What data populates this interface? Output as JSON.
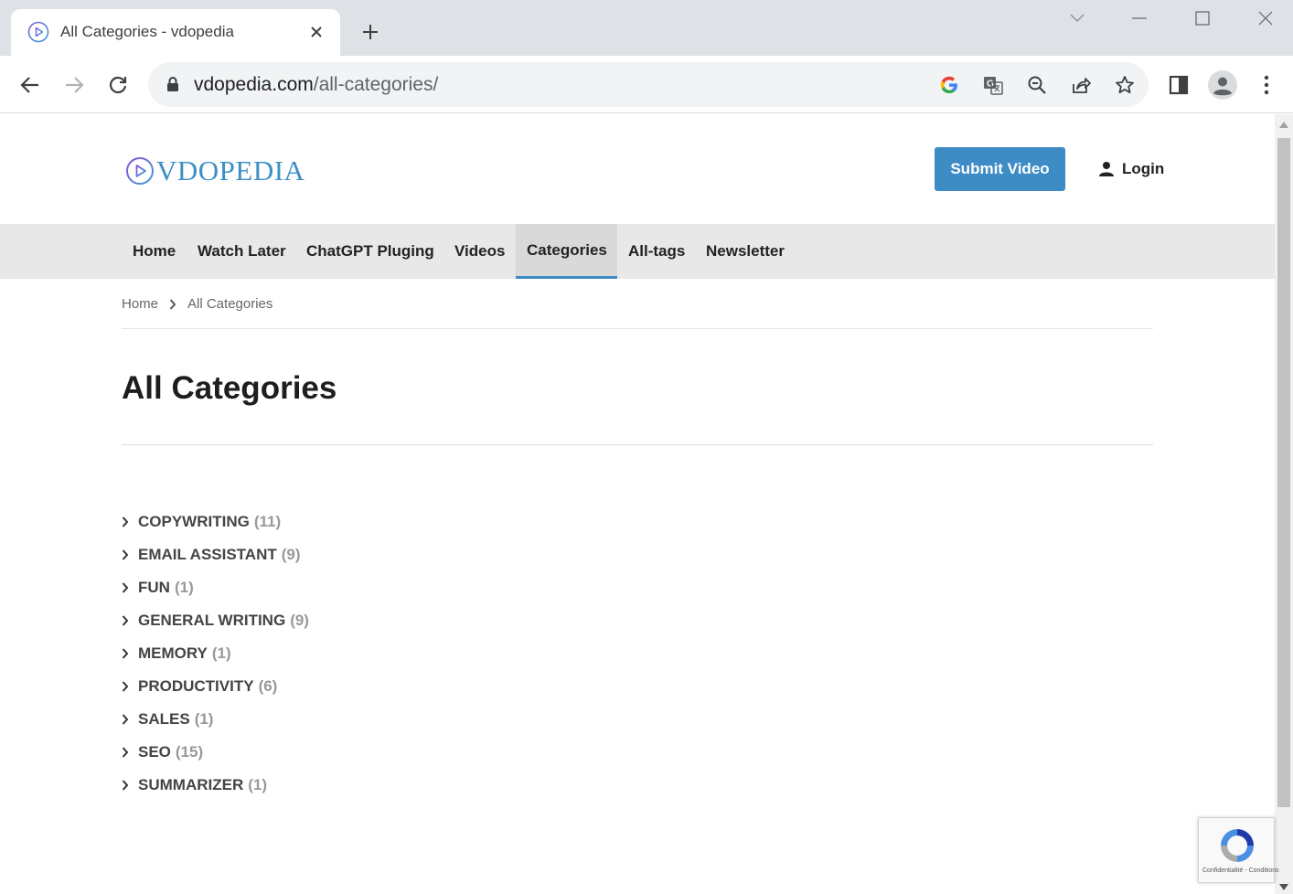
{
  "browser": {
    "tab_title": "All Categories - vdopedia",
    "url_domain": "vdopedia.com",
    "url_path": "/all-categories/",
    "icons": [
      "favicon-play-icon",
      "close-icon",
      "plus-icon",
      "chevron-down-icon",
      "minimize-icon",
      "maximize-icon",
      "window-close-icon",
      "back-arrow-icon",
      "forward-arrow-icon",
      "reload-icon",
      "lock-icon",
      "google-icon",
      "translate-icon",
      "zoom-out-icon",
      "share-icon",
      "star-icon",
      "side-panel-icon",
      "profile-icon",
      "more-vert-icon"
    ]
  },
  "site": {
    "logo_text": "VDOPEDIA",
    "submit_label": "Submit Video",
    "login_label": "Login",
    "accent_color": "#3d8cc6"
  },
  "menu": {
    "items": [
      {
        "label": "Home"
      },
      {
        "label": "Watch Later"
      },
      {
        "label": "ChatGPT Pluging"
      },
      {
        "label": "Videos"
      },
      {
        "label": "Categories"
      },
      {
        "label": "All-tags"
      },
      {
        "label": "Newsletter"
      }
    ],
    "active": "Categories"
  },
  "breadcrumb": {
    "home": "Home",
    "current": "All Categories"
  },
  "page": {
    "title": "All Categories"
  },
  "categories": [
    {
      "name": "COPYWRITING",
      "count": "(11)"
    },
    {
      "name": "EMAIL ASSISTANT",
      "count": "(9)"
    },
    {
      "name": "FUN",
      "count": "(1)"
    },
    {
      "name": "GENERAL WRITING",
      "count": "(9)"
    },
    {
      "name": "MEMORY",
      "count": "(1)"
    },
    {
      "name": "PRODUCTIVITY",
      "count": "(6)"
    },
    {
      "name": "SALES",
      "count": "(1)"
    },
    {
      "name": "SEO",
      "count": "(15)"
    },
    {
      "name": "SUMMARIZER",
      "count": "(1)"
    }
  ],
  "recaptcha": {
    "text": "Confidentialité - Conditions"
  }
}
